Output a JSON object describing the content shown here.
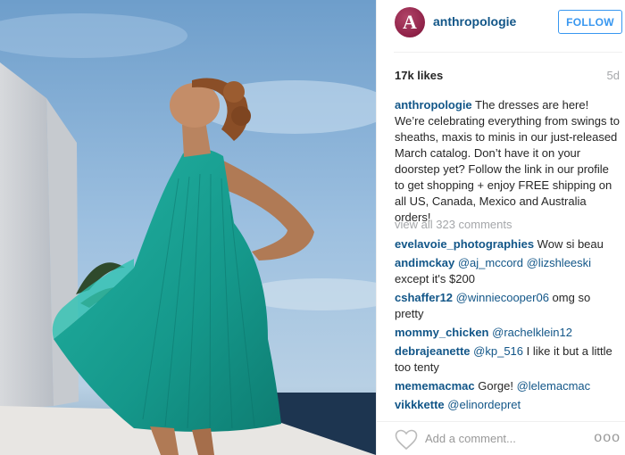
{
  "post": {
    "username": "anthropologie",
    "avatar_letter": "A",
    "follow_label": "FOLLOW",
    "likes": "17k likes",
    "age": "5d",
    "caption": {
      "username": "anthropologie",
      "text": " The dresses are here! We’re celebrating everything from swings to sheaths, maxis to minis in our just-released March catalog. Don’t have it on your doorstep yet? Follow the link in our profile to get shopping + enjoy FREE shipping on all US, Canada, Mexico and Australia orders!"
    },
    "view_all_comments": "view all 323 comments",
    "comments": [
      {
        "user": "evelavoie_photographies",
        "pre": " Wow si beau",
        "mention": "",
        "post": ""
      },
      {
        "user": "andimckay",
        "pre": " ",
        "mention": "@aj_mccord @lizshleeski",
        "post": " except it's $200"
      },
      {
        "user": "cshaffer12",
        "pre": " ",
        "mention": "@winniecooper06",
        "post": " omg so pretty"
      },
      {
        "user": "mommy_chicken",
        "pre": " ",
        "mention": "@rachelklein12",
        "post": ""
      },
      {
        "user": "debrajeanette",
        "pre": " ",
        "mention": "@kp_516",
        "post": " I like it but a little too tenty"
      },
      {
        "user": "mememacmac",
        "pre": " Gorge! ",
        "mention": "@lelemacmac",
        "post": ""
      },
      {
        "user": "vikkkette",
        "pre": " ",
        "mention": "@elinordepret",
        "post": ""
      }
    ],
    "add_comment_placeholder": "Add a comment...",
    "more_options": "ooo"
  },
  "colors": {
    "username_blue": "#125688",
    "follow_blue": "#3897f0",
    "muted_gray": "#a5a7aa",
    "dress_teal": "#1fa89a"
  },
  "icons": {
    "heart": "heart-icon",
    "more": "more-options-icon"
  }
}
